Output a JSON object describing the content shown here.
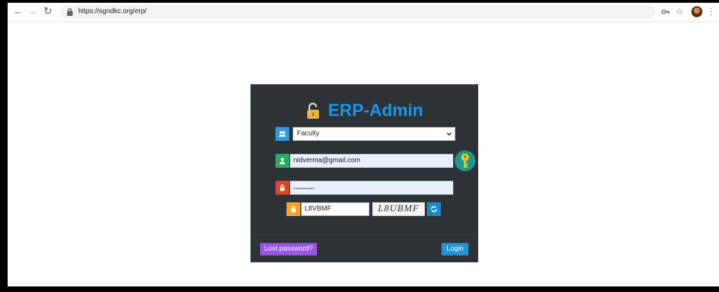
{
  "browser": {
    "url": "https://sgndkc.org/erp/",
    "back_icon": "arrow-left-icon",
    "forward_icon": "arrow-right-icon",
    "reload_icon": "reload-icon"
  },
  "login": {
    "title": "ERP-Admin",
    "role_select": {
      "value": "Faculty",
      "icon": "users-icon"
    },
    "email": {
      "value": "nidverma@gmail.com",
      "icon": "user-icon"
    },
    "password": {
      "value": "...........",
      "icon": "lock-icon"
    },
    "captcha": {
      "value": "L8VBMF",
      "image_text": "L8UBMF",
      "icon": "lock-icon"
    },
    "lost_password_label": "Lost password?",
    "login_label": "Login"
  },
  "colors": {
    "title": "#1e95e6",
    "panel": "#2d3237",
    "role_icon": "#2d9be0",
    "email_icon": "#27ae60",
    "password_icon": "#d9472b",
    "captcha_icon": "#f5a623",
    "lost_button": "#9b55e5",
    "login_button": "#2294d6",
    "key_button": "#1b9a8b"
  }
}
